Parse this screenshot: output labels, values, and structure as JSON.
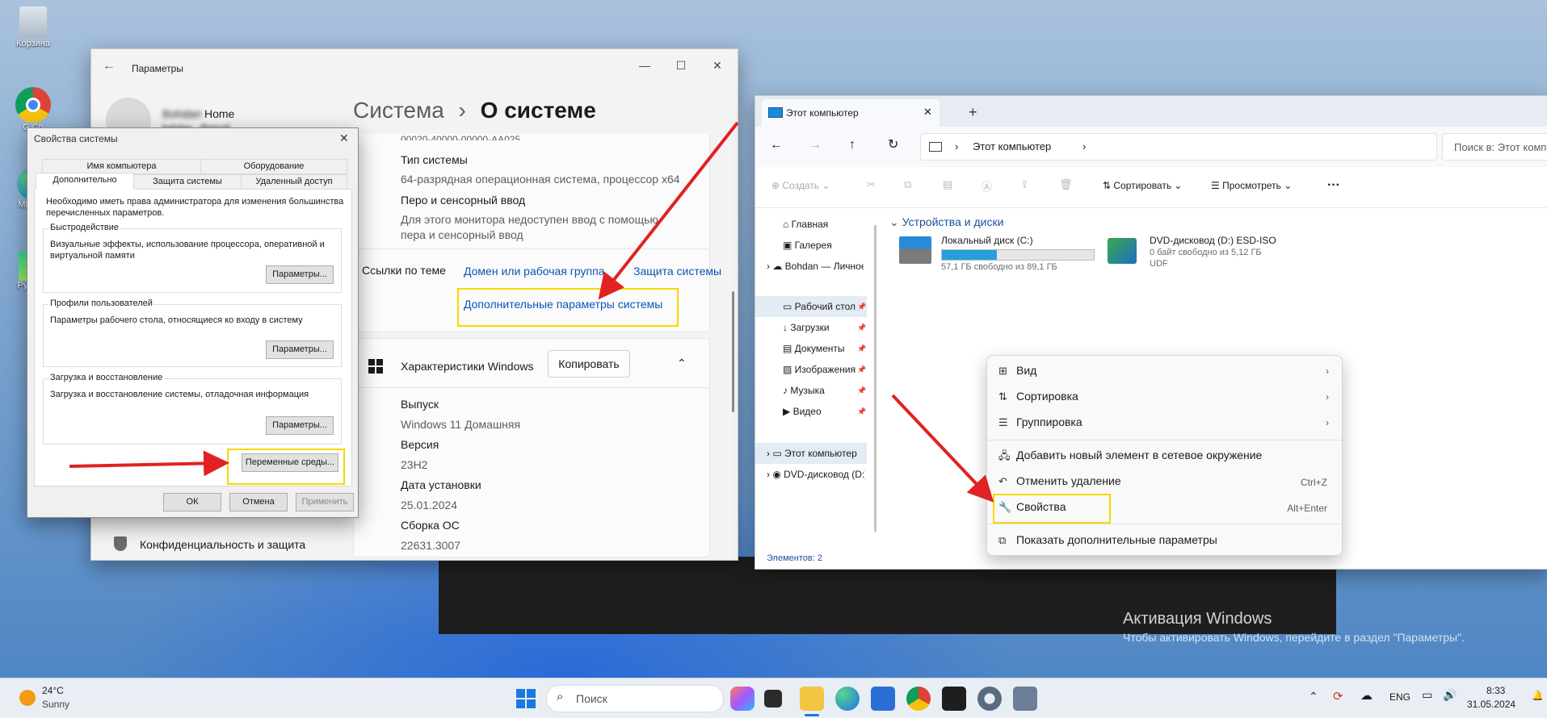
{
  "desktop": {
    "icons": [
      {
        "label": "Корзина"
      },
      {
        "label": "G Ch"
      },
      {
        "label": "Micro E"
      },
      {
        "label": "Py Com"
      }
    ],
    "activation": {
      "title": "Активация Windows",
      "subtitle": "Чтобы активировать Windows, перейдите в раздел \"Параметры\"."
    }
  },
  "settings": {
    "app_title": "Параметры",
    "user_name": "Bohdan",
    "user_email": "bohdan...@gmail...",
    "user_plan": "Home",
    "breadcrumb": {
      "parent": "Система",
      "sep": "›",
      "current": "О системе"
    },
    "partial_top": "00020-40000-00000-AA025",
    "system_type_label": "Тип системы",
    "system_type_value": "64-разрядная операционная система, процессор x64",
    "pen_label": "Перо и сенсорный ввод",
    "pen_value_1": "Для этого монитора недоступен ввод с помощью",
    "pen_value_2": "пера и сенсорный ввод",
    "links_label": "Ссылки по теме",
    "link_domain": "Домен или рабочая группа",
    "link_protection": "Защита системы",
    "link_advanced": "Дополнительные параметры системы",
    "win_spec_title": "Характеристики Windows",
    "copy_button": "Копировать",
    "spec_rows": [
      {
        "label": "Выпуск",
        "value": "Windows 11 Домашняя"
      },
      {
        "label": "Версия",
        "value": "23H2"
      },
      {
        "label": "Дата установки",
        "value": "25.01.2024"
      },
      {
        "label": "Сборка ОС",
        "value": "22631.3007"
      }
    ],
    "sidebar_privacy": "Конфиденциальность и защита"
  },
  "dialog": {
    "title": "Свойства системы",
    "tabs_row1": [
      "Имя компьютера",
      "Оборудование"
    ],
    "tabs_row2": [
      "Дополнительно",
      "Защита системы",
      "Удаленный доступ"
    ],
    "admin_note": "Необходимо иметь права администратора для изменения большинства перечисленных параметров.",
    "performance_title": "Быстродействие",
    "performance_desc": "Визуальные эффекты, использование процессора, оперативной и виртуальной памяти",
    "profiles_title": "Профили пользователей",
    "profiles_desc": "Параметры рабочего стола, относящиеся ко входу в систему",
    "startup_title": "Загрузка и восстановление",
    "startup_desc": "Загрузка и восстановление системы, отладочная информация",
    "params_button": "Параметры...",
    "env_button": "Переменные среды...",
    "ok": "ОК",
    "cancel": "Отмена",
    "apply": "Применить"
  },
  "explorer": {
    "tab_title": "Этот компьютер",
    "address": "Этот компьютер",
    "search_placeholder": "Поиск в: Этот компьютер",
    "toolbar": {
      "create": "Создать",
      "sort": "Сортировать",
      "view": "Просмотреть",
      "more": "···"
    },
    "nav": {
      "home": "Главная",
      "gallery": "Галерея",
      "onedrive": "Bohdan — Личное",
      "quick": [
        {
          "label": "Рабочий стол"
        },
        {
          "label": "Загрузки"
        },
        {
          "label": "Документы"
        },
        {
          "label": "Изображения"
        },
        {
          "label": "Музыка"
        },
        {
          "label": "Видео"
        }
      ],
      "this_pc": "Этот компьютер",
      "dvd": "DVD-дисковод (D:)"
    },
    "section_title": "Устройства и диски",
    "drive_c": {
      "name": "Локальный диск (C:)",
      "free": "57,1 ГБ свободно из 89,1 ГБ",
      "used_fraction": 0.36
    },
    "drive_d": {
      "name": "DVD-дисковод (D:) ESD-ISO",
      "free": "0 байт свободно из 5,12 ГБ",
      "fs": "UDF"
    },
    "status": "Элементов: 2"
  },
  "context_menu": {
    "items": [
      {
        "label": "Вид",
        "shortcut": ""
      },
      {
        "label": "Сортировка",
        "shortcut": ""
      },
      {
        "label": "Группировка",
        "shortcut": ""
      },
      {
        "label": "Добавить новый элемент в сетевое окружение",
        "shortcut": ""
      },
      {
        "label": "Отменить удаление",
        "shortcut": "Ctrl+Z"
      },
      {
        "label": "Свойства",
        "shortcut": "Alt+Enter"
      },
      {
        "label": "Показать дополнительные параметры",
        "shortcut": ""
      }
    ]
  },
  "taskbar": {
    "weather_temp": "24°C",
    "weather_desc": "Sunny",
    "search_placeholder": "Поиск",
    "lang": "ENG",
    "time": "8:33",
    "date": "31.05.2024"
  },
  "colors": {
    "highlight": "#f7d800",
    "arrow": "#e02222",
    "accent": "#0a55b8"
  }
}
